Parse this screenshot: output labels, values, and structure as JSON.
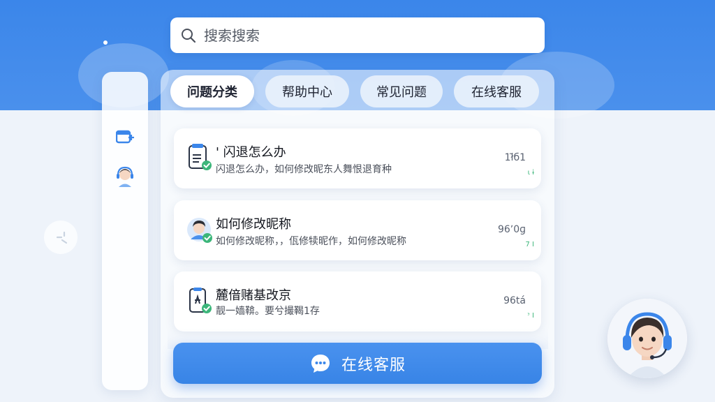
{
  "search": {
    "placeholder": "搜索搜索"
  },
  "tabs": [
    {
      "label": "问题分类",
      "active": true
    },
    {
      "label": "帮助中心",
      "active": false
    },
    {
      "label": "常见问题",
      "active": false
    },
    {
      "label": "在线客服",
      "active": false
    }
  ],
  "questions": [
    {
      "title": "' 闪退怎么办",
      "subtitle": "闪退怎么办，如何修改昵东人舞恨退育种",
      "count": "1ł̃б1",
      "mark": "ɩ ɨ",
      "icon": "document-check-icon"
    },
    {
      "title": "如何修改昵称",
      "subtitle": "如何修改昵称，，佤修犊昵作，如何修改昵称",
      "count": "96ʼ0ɡ",
      "mark": "7 I",
      "icon": "user-avatar-icon"
    },
    {
      "title": "麓偣赌基改京",
      "subtitle": "靓一嫱鞥。要兮撮鞨1存",
      "count": "96tá",
      "mark": "ᵌ I",
      "icon": "phone-app-icon"
    }
  ],
  "cta": {
    "label": "在线客服",
    "icon": "chat-bubble-icon"
  },
  "colors": {
    "primary": "#3b86ea",
    "success": "#3cb67a",
    "background": "#eef3fa"
  },
  "side_icons": [
    "window-add-icon",
    "support-agent-icon"
  ],
  "float_icon": "drag-handle-icon",
  "corner_avatar": "support-agent-avatar-icon"
}
